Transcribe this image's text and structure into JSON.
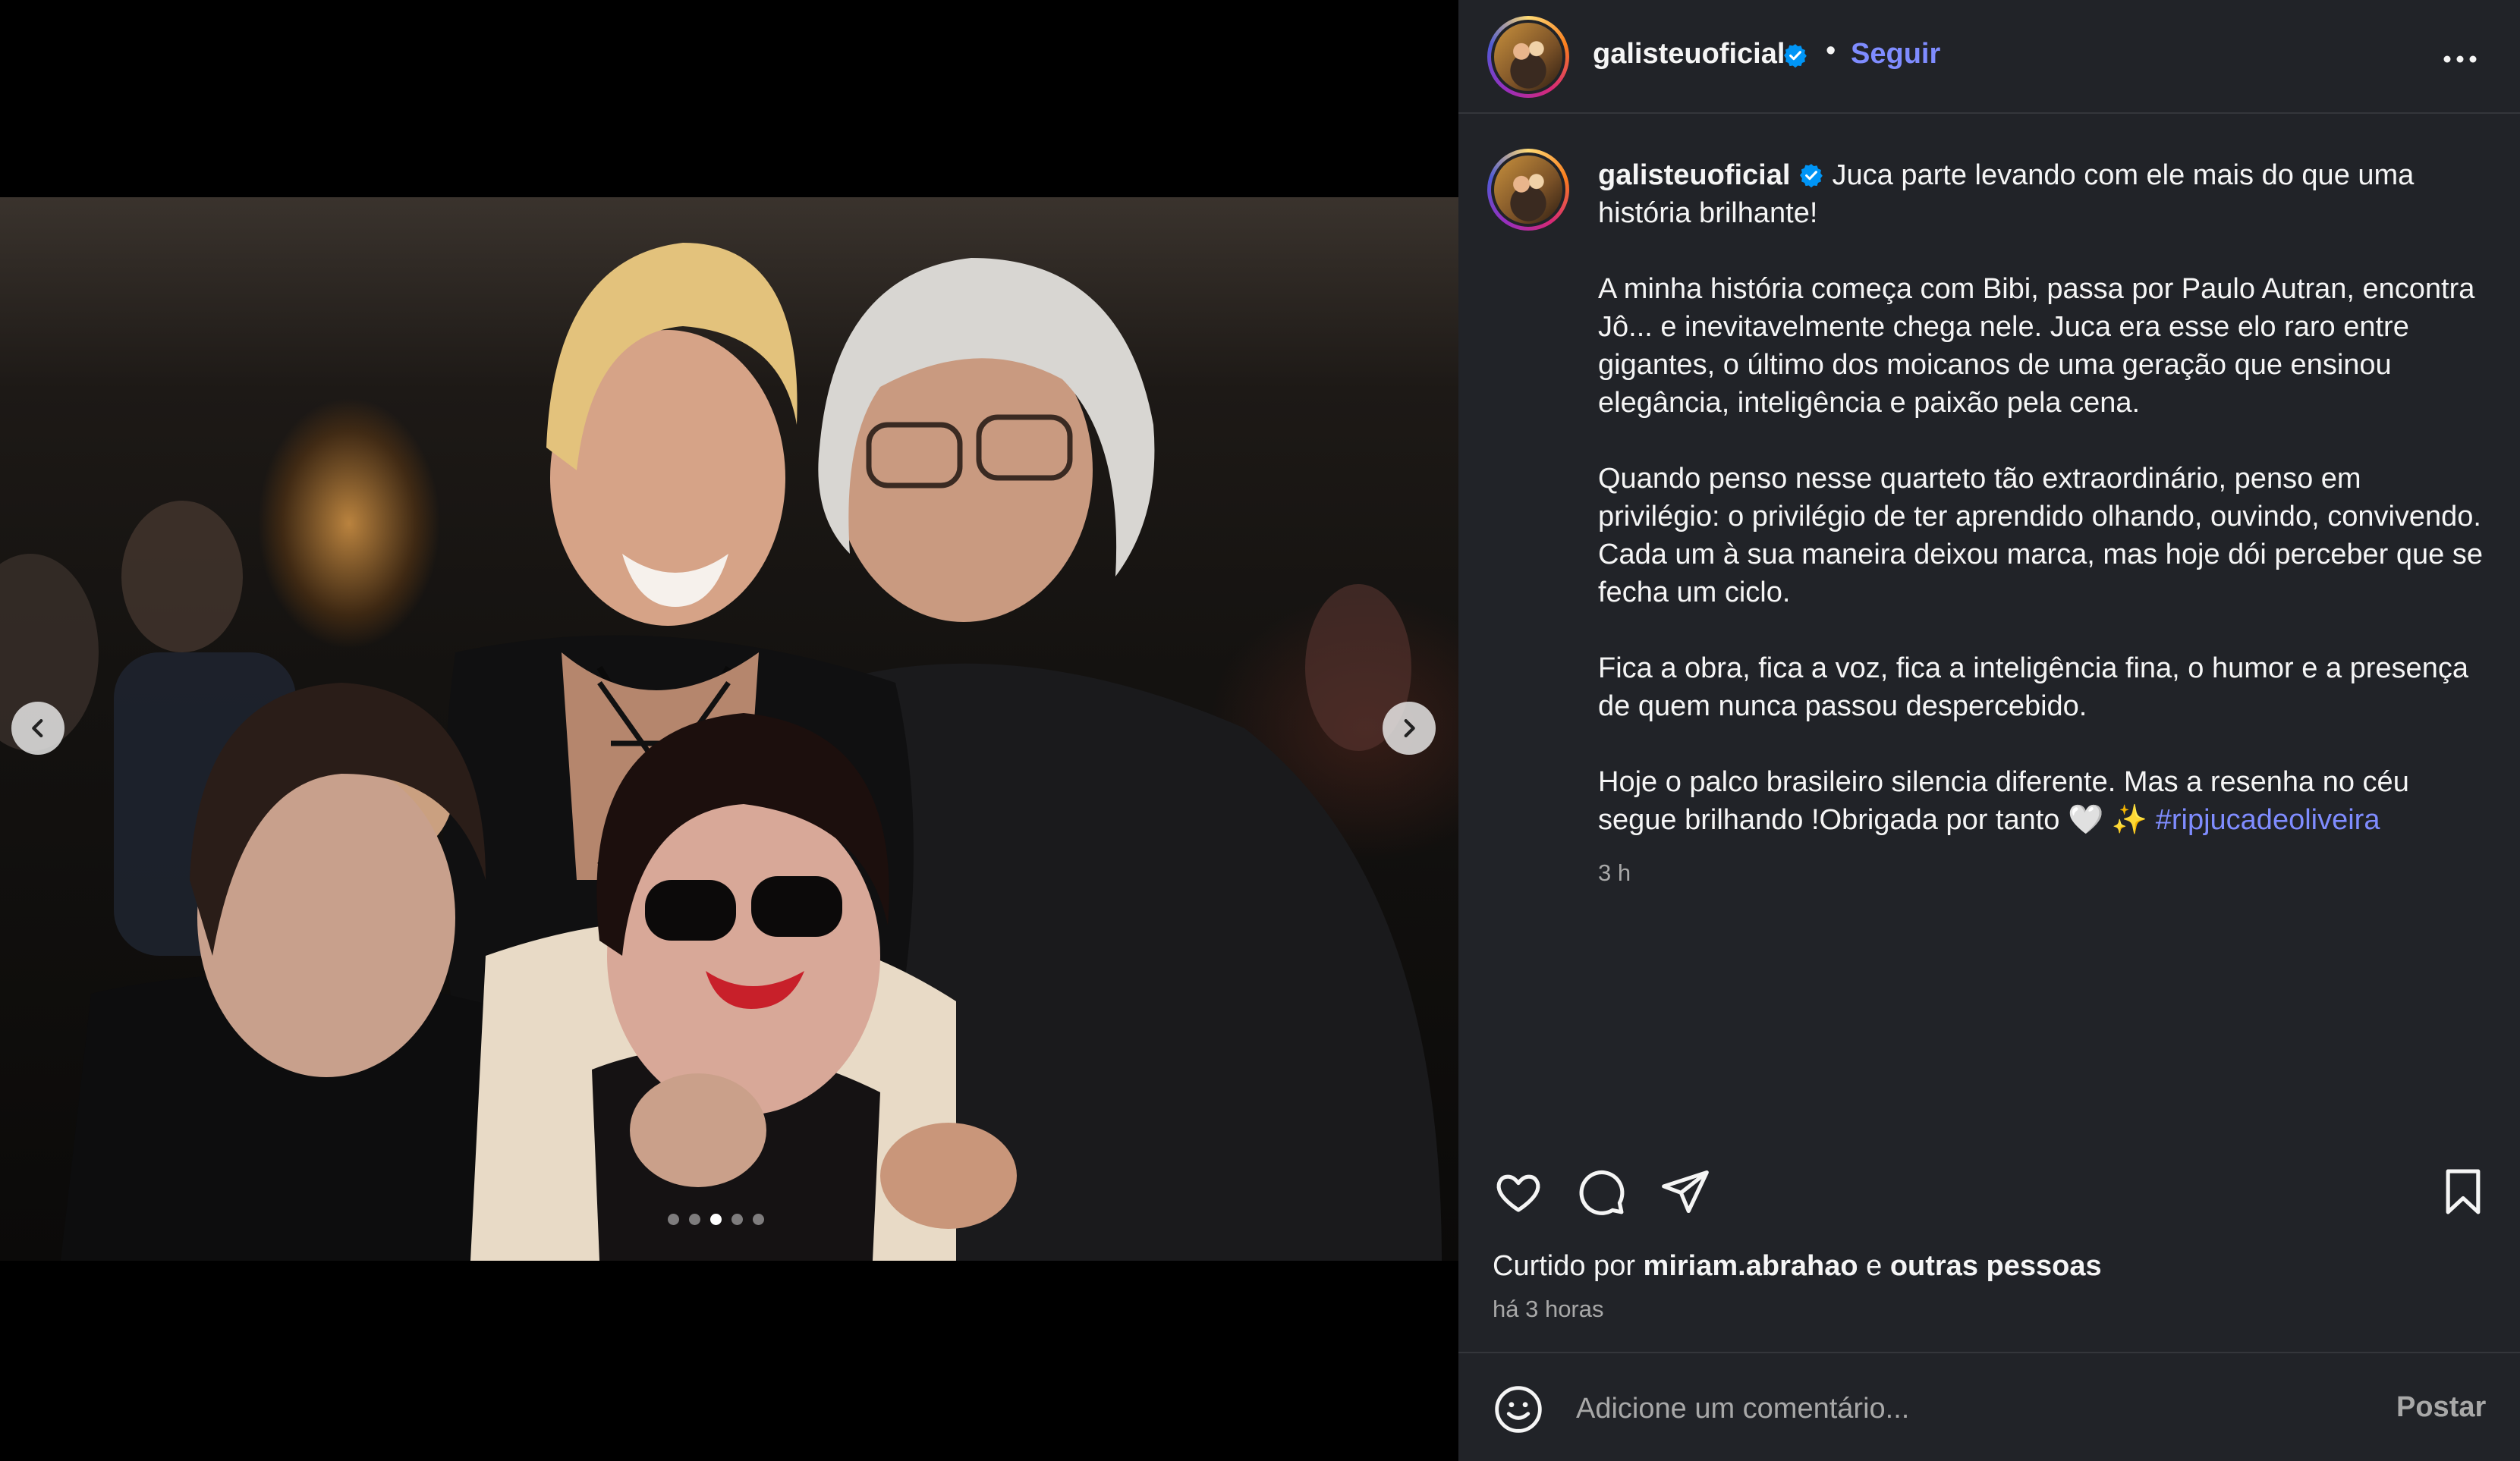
{
  "post": {
    "username": "galisteuoficial",
    "follow_label": "Seguir",
    "separator": "•",
    "verified": true,
    "carousel": {
      "slide_count": 5,
      "active_slide": 3
    }
  },
  "caption": {
    "username": "galisteuoficial",
    "paragraphs": [
      "Juca parte levando com ele mais do que uma história brilhante!",
      "A minha história começa com Bibi, passa por Paulo Autran, encontra Jô... e inevitavelmente chega nele. Juca era esse elo raro entre gigantes, o último dos moicanos de uma geração que ensinou elegância, inteligência e paixão pela cena.",
      "Quando penso nesse quarteto tão extraordinário, penso em privilégio: o privilégio de ter aprendido olhando, ouvindo, convivendo. Cada um à sua maneira deixou marca, mas hoje dói perceber que se fecha um ciclo.",
      "Fica a obra, fica a voz, fica a inteligência fina, o humor e a presença de quem nunca passou despercebido.",
      "Hoje o palco brasileiro silencia diferente. Mas a resenha no céu segue brilhando !Obrigada por tanto 🤍 ✨"
    ],
    "hashtag": "#ripjucadeoliveira",
    "timestamp": "3 h"
  },
  "engagement": {
    "liked_by_prefix": "Curtido por",
    "liked_by_user": "miriam.abrahao",
    "liked_by_conjunction": "e",
    "liked_by_others": "outras pessoas",
    "posted_ago": "há 3 horas"
  },
  "comment_box": {
    "placeholder": "Adicione um comentário...",
    "post_label": "Postar"
  },
  "icons": {
    "like": "heart-icon",
    "comment": "comment-bubble-icon",
    "share": "paper-plane-icon",
    "save": "bookmark-icon",
    "more": "more-options-icon",
    "emoji": "emoji-icon",
    "prev": "chevron-left-icon",
    "next": "chevron-right-icon"
  },
  "colors": {
    "sidebar_bg": "#212328",
    "link_blue": "#7f8cff",
    "verified_blue": "#0095f6",
    "muted_text": "#a8a8a8"
  }
}
